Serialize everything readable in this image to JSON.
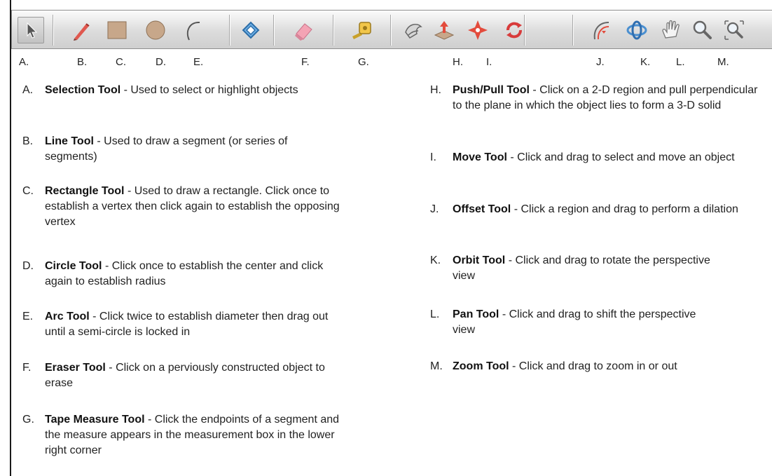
{
  "toolbar": {
    "tools": [
      {
        "icon": "selection-arrow-icon",
        "tooltip": "Selection Tool"
      },
      {
        "icon": "pencil-line-icon",
        "tooltip": "Line Tool"
      },
      {
        "icon": "rectangle-icon",
        "tooltip": "Rectangle Tool"
      },
      {
        "icon": "circle-icon",
        "tooltip": "Circle Tool"
      },
      {
        "icon": "arc-icon",
        "tooltip": "Arc Tool"
      },
      {
        "icon": "paint-bucket-icon",
        "tooltip": ""
      },
      {
        "icon": "eraser-icon",
        "tooltip": "Eraser Tool"
      },
      {
        "icon": "tape-measure-icon",
        "tooltip": "Tape Measure Tool"
      },
      {
        "icon": "push-pull-icon",
        "tooltip": "Push/Pull Tool"
      },
      {
        "icon": "move-icon",
        "tooltip": "Move Tool"
      },
      {
        "icon": "offset-icon",
        "tooltip": "Offset Tool"
      },
      {
        "icon": "orbit-icon",
        "tooltip": "Orbit Tool"
      },
      {
        "icon": "pan-hand-icon",
        "tooltip": "Pan Tool"
      },
      {
        "icon": "zoom-magnifier-icon",
        "tooltip": "Zoom Tool"
      },
      {
        "icon": "zoom-extents-icon",
        "tooltip": ""
      }
    ],
    "colors": {
      "background": "#d8d8d8",
      "pencil": "#e0584f",
      "rectangle": "#c7a78a",
      "circle": "#c7a78a",
      "accent_blue": "#4a8fd0",
      "rotate_red": "#d83b3b"
    }
  },
  "letters": [
    "A.",
    "B.",
    "C.",
    "D.",
    "E.",
    "F.",
    "G.",
    "H.",
    "I.",
    "J.",
    "K.",
    "L.",
    "M."
  ],
  "left_descriptions": [
    {
      "marker": "A.",
      "name": "Selection Tool",
      "text": " - Used to select or highlight objects"
    },
    {
      "marker": "B.",
      "name": "Line Tool",
      "text": " - Used to draw a segment (or series of segments)"
    },
    {
      "marker": "C.",
      "name": "Rectangle Tool",
      "text": " - Used to draw a rectangle. Click once to establish a vertex then click again to establish the opposing vertex"
    },
    {
      "marker": "D.",
      "name": "Circle Tool",
      "text": " - Click once to establish the center and click again to establish radius"
    },
    {
      "marker": "E.",
      "name": "Arc Tool",
      "text": " - Click twice to establish diameter then drag out until a semi-circle is locked in"
    },
    {
      "marker": "F.",
      "name": "Eraser Tool",
      "text": " - Click on a perviously constructed object to erase"
    },
    {
      "marker": "G.",
      "name": "Tape Measure Tool",
      "text": " - Click the endpoints of a segment and the measure appears in the measurement box in the lower right corner"
    }
  ],
  "right_descriptions": [
    {
      "marker": "H.",
      "name": "Push/Pull Tool",
      "text": " - Click on a 2-D region and pull perpendicular to the plane in which the object lies to form a 3-D solid"
    },
    {
      "marker": "I.",
      "name": "Move Tool",
      "text": " - Click and drag to select and move an object"
    },
    {
      "marker": "J.",
      "name": "Offset Tool",
      "text": " - Click a region and drag to perform a dilation"
    },
    {
      "marker": "K.",
      "name": "Orbit Tool",
      "text": " - Click and drag to rotate the perspective view"
    },
    {
      "marker": "L.",
      "name": "Pan Tool",
      "text": " - Click and drag to shift the perspective view"
    },
    {
      "marker": "M.",
      "name": "Zoom Tool",
      "text": " - Click and drag to zoom in or out"
    }
  ]
}
